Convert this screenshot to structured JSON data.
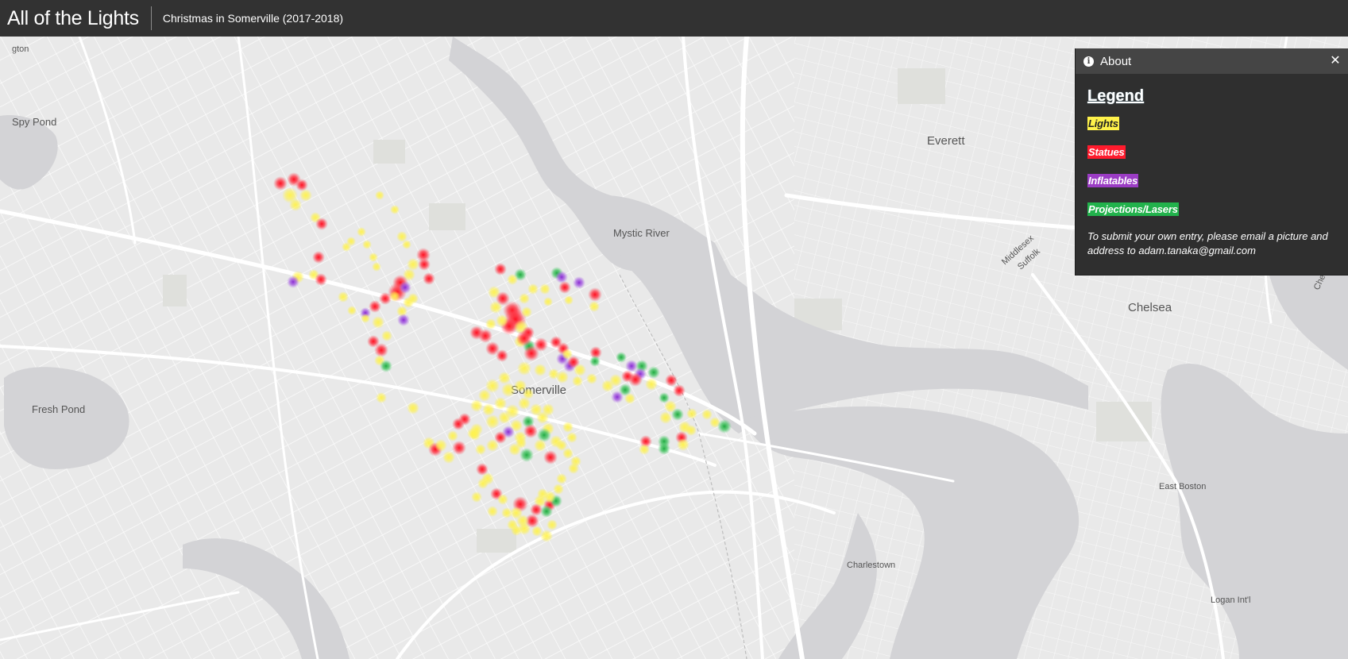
{
  "header": {
    "title": "All of the Lights",
    "subtitle": "Christmas in Somerville (2017-2018)"
  },
  "about_panel": {
    "title": "About",
    "info_icon": "info-icon",
    "close_icon": "close-icon",
    "legend_heading": "Legend",
    "legend_items": [
      {
        "label": "Lights",
        "color": "#fff24a",
        "text_color": "#222222"
      },
      {
        "label": "Statues",
        "color": "#ff1b2d",
        "text_color": "#ffffff"
      },
      {
        "label": "Inflatables",
        "color": "#9b3cc4",
        "text_color": "#ffffff"
      },
      {
        "label": "Projections/Lasers",
        "color": "#22b24c",
        "text_color": "#ffffff"
      }
    ],
    "submit_note": "To submit your own entry, please email a picture and address to adam.tanaka@gmail.com"
  },
  "map": {
    "labels": {
      "somerville": "Somerville",
      "everett": "Everett",
      "chelsea": "Chelsea",
      "mystic_river": "Mystic River",
      "fresh_pond": "Fresh Pond",
      "spy_pond": "Spy Pond",
      "east_boston": "East Boston",
      "charlestown": "Charlestown",
      "logan": "Logan Int'l",
      "arlington_partial": "gton",
      "middlesex": "Middlesex",
      "suffolk": "Suffolk",
      "chelsea_river": "Chelsea"
    },
    "colors": {
      "land": "#e9e9e9",
      "water": "#d3d3d6",
      "road": "#ffffff",
      "park": "#dedfdc"
    }
  }
}
